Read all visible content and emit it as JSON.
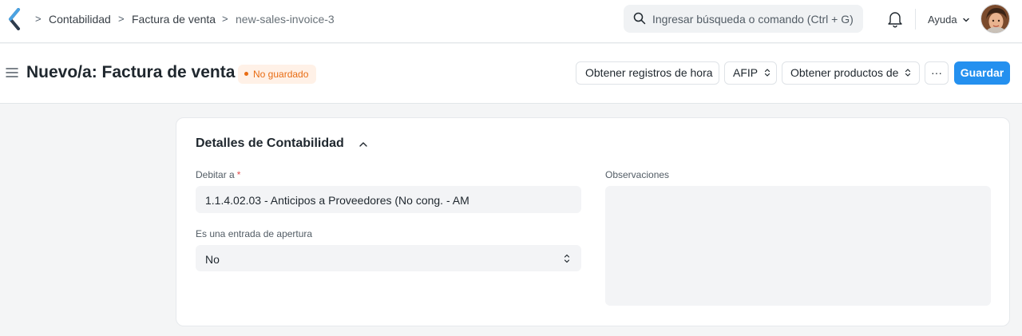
{
  "navbar": {
    "breadcrumbs": [
      "Contabilidad",
      "Factura de venta",
      "new-sales-invoice-3"
    ],
    "breadcrumb_separator": ">",
    "search_placeholder": "Ingresar búsqueda o comando (Ctrl + G)",
    "help_label": "Ayuda",
    "logo_icon": "chevron-left-logo-icon",
    "notification_icon": "bell-icon",
    "accent_color": "#2490ef"
  },
  "page": {
    "title": "Nuevo/a: Factura de venta",
    "status": "No guardado",
    "status_color": "#e86c13",
    "actions": {
      "time_records": "Obtener registros de hora",
      "afip": "AFIP",
      "get_items": "Obtener productos de",
      "more": "···",
      "save": "Guardar"
    }
  },
  "form": {
    "section_title": "Detalles de Contabilidad",
    "debit_to": {
      "label": "Debitar a",
      "required_mark": "*",
      "value": "1.1.4.02.03 - Anticipos a Proveedores (No cong. - AM"
    },
    "opening_entry": {
      "label": "Es una entrada de apertura",
      "value": "No"
    },
    "remarks": {
      "label": "Observaciones",
      "value": ""
    }
  }
}
